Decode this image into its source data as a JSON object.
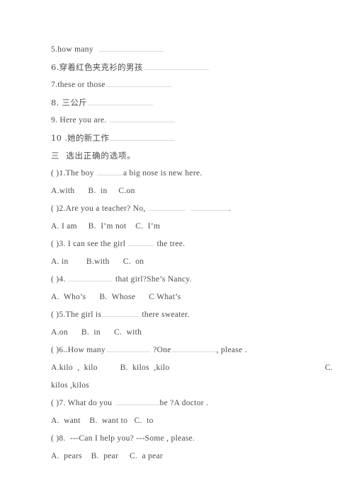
{
  "document": {
    "type": "worksheet",
    "language": "zh-CN + en",
    "text_color": "#4a4a4a",
    "blank_color": "#d9d9d9",
    "background": "#ffffff"
  },
  "translation_items": [
    {
      "number": "5.",
      "text": "how many",
      "blank": "w-xxl"
    },
    {
      "number": "6.",
      "text": "穿着红色夹克衫的男孩",
      "blank": "w-xxl"
    },
    {
      "number": "7.",
      "text": "these or those",
      "blank": "w-xxl"
    },
    {
      "number": "8.",
      "text": " 三公斤",
      "blank": "w-xxl"
    },
    {
      "number": "9.",
      "text": " Here you are. ",
      "blank": "w-xxl"
    },
    {
      "number": "10 .",
      "text": "她的新工作",
      "blank": "w-xxl"
    }
  ],
  "section": {
    "heading": "三  选出正确的选项。"
  },
  "questions": [
    {
      "marker": "( )1.",
      "stem_before": "The boy ",
      "blank": "w-sm",
      "stem_after": "a big nose is new here.",
      "options": "A.with      B.  in     C.on"
    },
    {
      "marker": "( )2.",
      "stem_before": "Are you a teacher? No, ",
      "blank": "w-md",
      "stem_after": "",
      "blank2": "w-md",
      "stem_end": ".",
      "options": "A. I am     B.  I’m not    C.  I’m"
    },
    {
      "marker": "( )3.",
      "stem_before": " I can see the girl ",
      "blank": "w-sm",
      "stem_after": " the tree.",
      "options": "A. in        B.with      C.  on"
    },
    {
      "marker": "( )4.",
      "stem_before": " ",
      "blank": "w-lg",
      "stem_after": " that girl?She’s Nancy.",
      "options": "A.  Who’s      B.  Whose      C What’s"
    },
    {
      "marker": "( )5.",
      "stem_before": "The girl is",
      "blank": "w-md",
      "stem_after": " there sweater.",
      "options": "A.on      B.  in      C.  with"
    },
    {
      "marker": "( )6..",
      "stem_before": "How many",
      "blank": "w-lg",
      "stem_after": " ?One",
      "blank2": "w-lg",
      "stem_end": ", please .",
      "options": "A.kilo  ,  kilo          B.  kilos  ,kilo",
      "options_tail": "C.",
      "options_wrap": "kilos ,kilos"
    },
    {
      "marker": "( )7.",
      "stem_before": " What do you ",
      "blank": "w-lg",
      "stem_after": "be ?A doctor .",
      "options": "A.  want    B.  want to   C.  to"
    },
    {
      "marker": "( )8.",
      "stem_before": "  ---Can I help you? ---Some , please.",
      "blank": "",
      "stem_after": "",
      "options": "A.  pears    B.  pear     C.  a pear"
    }
  ]
}
